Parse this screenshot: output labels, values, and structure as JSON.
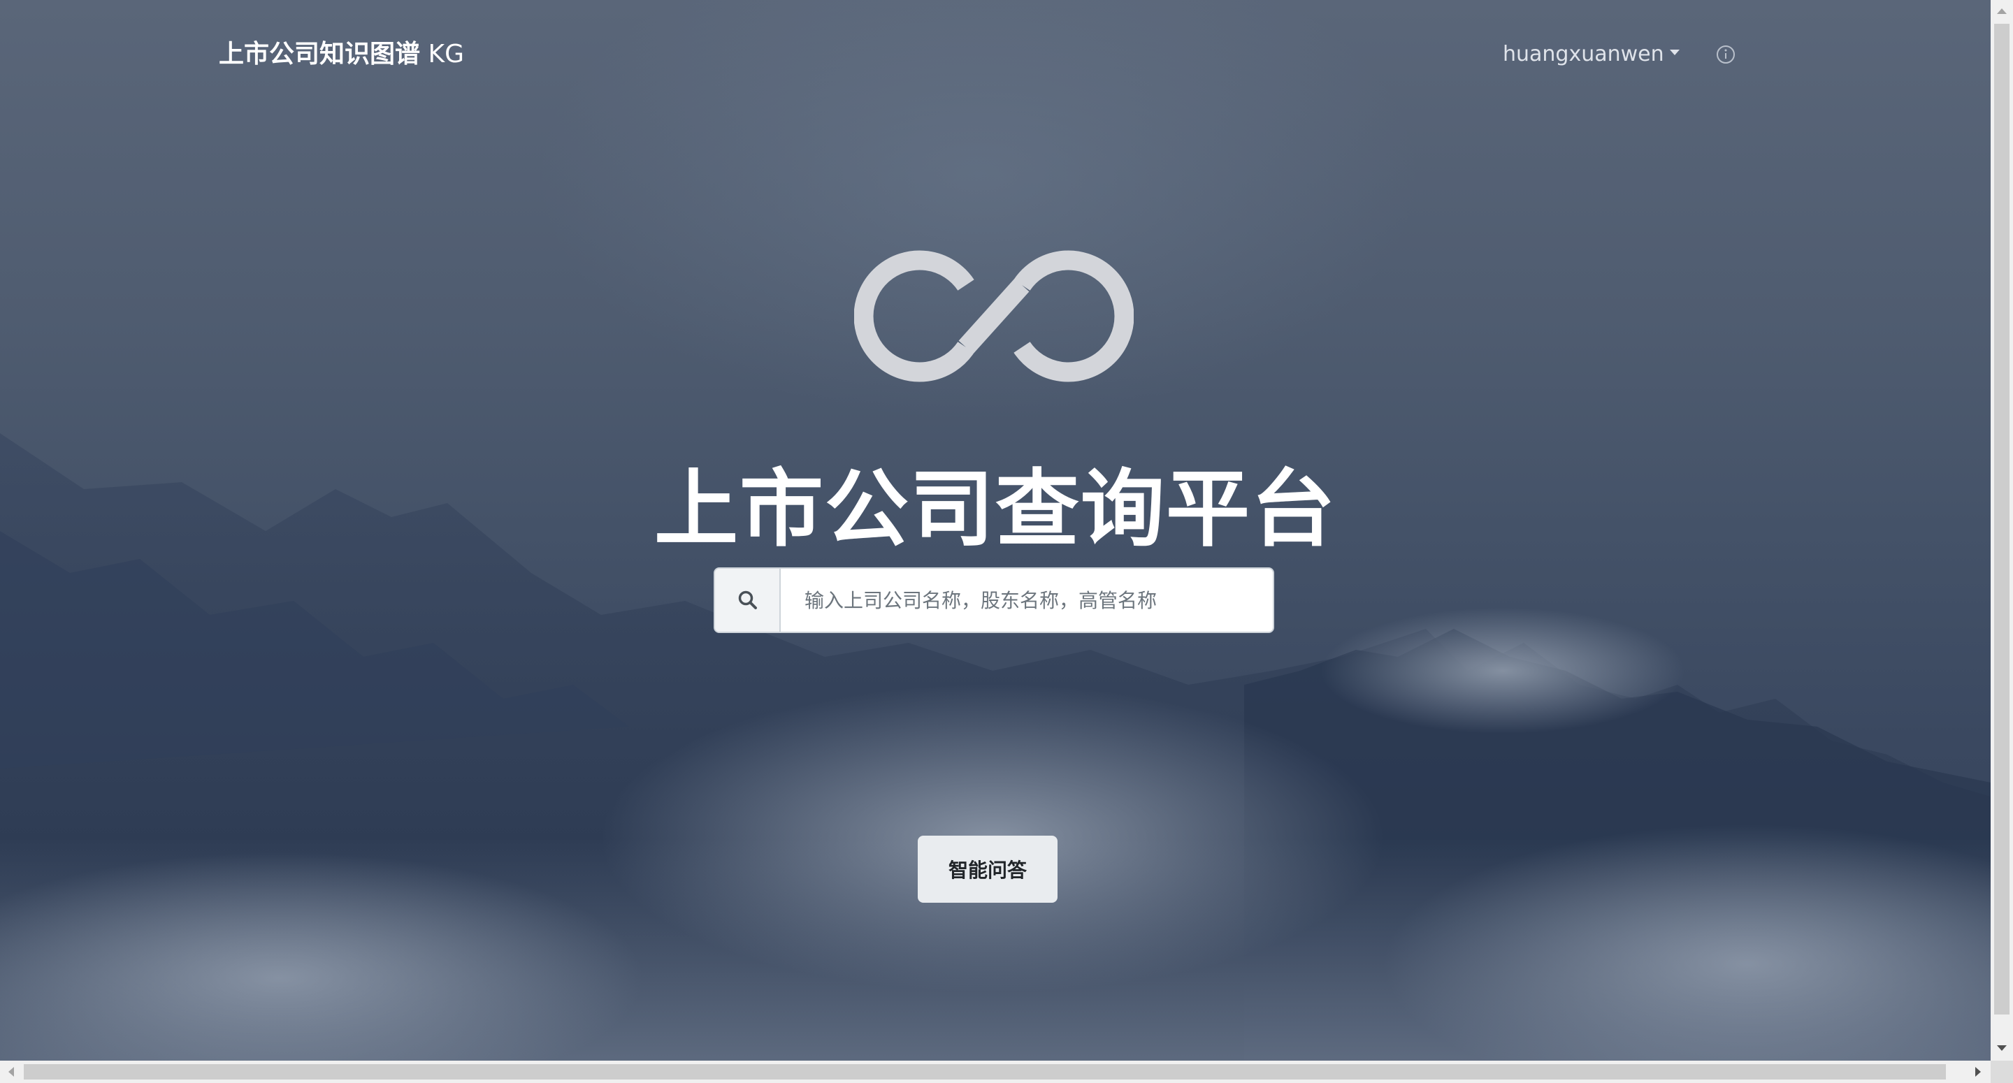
{
  "navbar": {
    "brand_cn": "上市公司知识图谱",
    "brand_suffix": "KG",
    "username": "huangxuanwen",
    "info_icon": "info-circle-icon"
  },
  "hero": {
    "logo_icon": "infinity-logo-icon",
    "title": "上市公司查询平台"
  },
  "search": {
    "icon": "search-icon",
    "placeholder": "输入上司公司名称，股东名称，高管名称",
    "value": ""
  },
  "qa_button": {
    "label": "智能问答"
  },
  "colors": {
    "background_top": "#5a6679",
    "background_bottom": "#2f3d55",
    "logo": "#d3d5da",
    "button_bg": "#e9ecef"
  }
}
